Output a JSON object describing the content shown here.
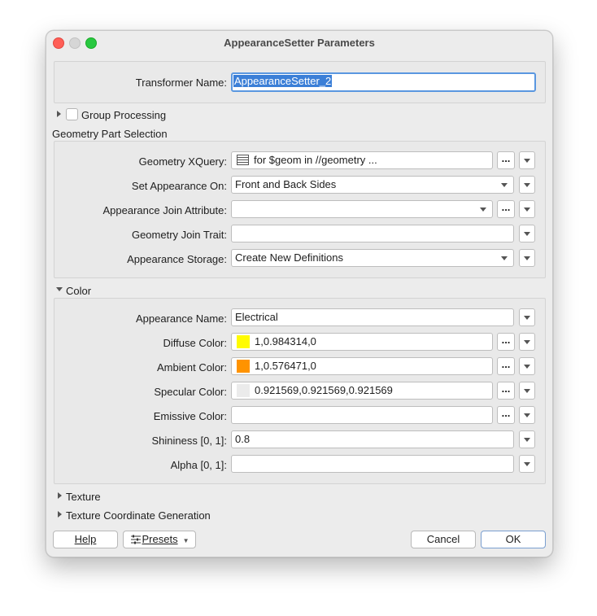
{
  "window": {
    "title": "AppearanceSetter Parameters"
  },
  "transformer": {
    "name_label": "Transformer Name:",
    "name_value": "AppearanceSetter_2"
  },
  "group_processing": {
    "label": "Group Processing",
    "checked": false
  },
  "geometry_section": {
    "title": "Geometry Part Selection",
    "xquery_label": "Geometry XQuery:",
    "xquery_value": "for $geom in //geometry ...",
    "set_appearance_label": "Set Appearance On:",
    "set_appearance_value": "Front and Back Sides",
    "join_attr_label": "Appearance Join Attribute:",
    "join_attr_value": "",
    "join_trait_label": "Geometry Join Trait:",
    "join_trait_value": "",
    "storage_label": "Appearance Storage:",
    "storage_value": "Create New Definitions"
  },
  "color_section": {
    "title": "Color",
    "appearance_name_label": "Appearance Name:",
    "appearance_name_value": "Electrical",
    "diffuse_label": "Diffuse Color:",
    "diffuse_value": "1,0.984314,0",
    "diffuse_swatch": "#fffb00",
    "ambient_label": "Ambient Color:",
    "ambient_value": "1,0.576471,0",
    "ambient_swatch": "#ff9300",
    "specular_label": "Specular Color:",
    "specular_value": "0.921569,0.921569,0.921569",
    "specular_swatch": "#ebebeb",
    "emissive_label": "Emissive Color:",
    "emissive_value": "",
    "shininess_label": "Shininess [0, 1]:",
    "shininess_value": "0.8",
    "alpha_label": "Alpha [0, 1]:",
    "alpha_value": ""
  },
  "collapsed_sections": {
    "texture": "Texture",
    "texture_coord": "Texture Coordinate Generation"
  },
  "ellipsis": "...",
  "buttons": {
    "help": "Help",
    "presets": "Presets",
    "cancel": "Cancel",
    "ok": "OK"
  },
  "icons": {
    "close": "close-icon",
    "minimize": "minimize-icon",
    "maximize": "maximize-icon",
    "text_editor": "text-editor-icon",
    "presets": "sliders-icon"
  }
}
